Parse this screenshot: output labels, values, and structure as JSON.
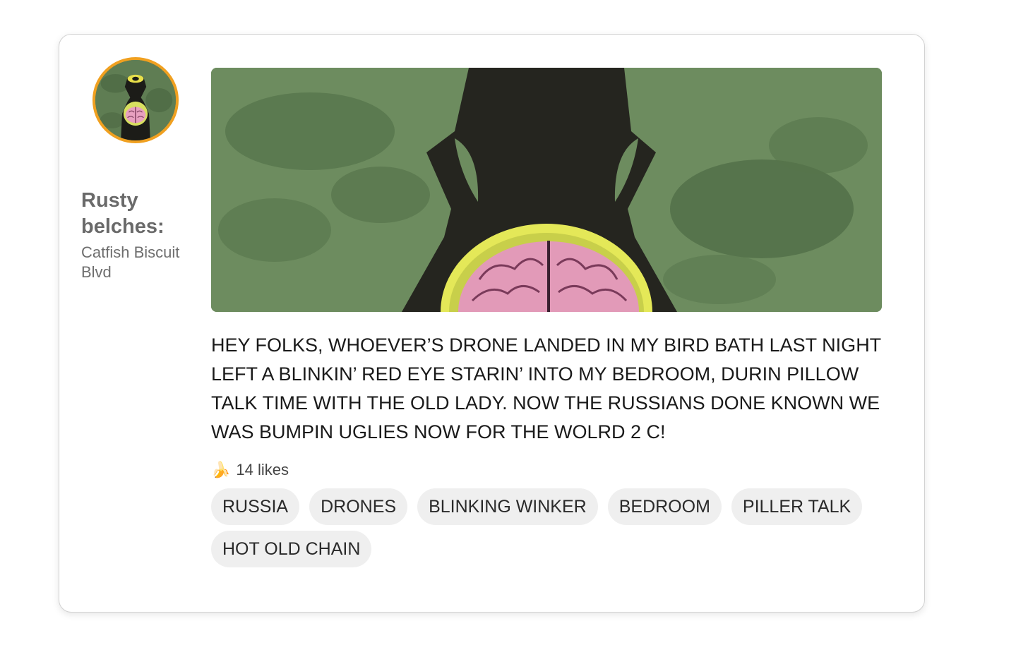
{
  "author": {
    "name": "Rusty belches:",
    "location": "Catfish Biscuit Blvd"
  },
  "post": {
    "body": "HEY FOLKS, WHOEVER’S DRONE LANDED IN MY BIRD BATH LAST NIGHT LEFT A BLINKIN’ RED EYE STARIN’ INTO MY BEDROOM, DURIN PILLOW TALK TIME WITH THE OLD LADY. NOW THE RUSSIANS DONE KNOWN WE WAS BUMPIN UGLIES NOW FOR THE WOLRD 2 C!",
    "likes_icon": "🍌",
    "likes_label": "14 likes",
    "tags": [
      "RUSSIA",
      "DRONES",
      "BLINKING WINKER",
      "BEDROOM",
      "PILLER TALK",
      "HOT OLD CHAIN"
    ]
  },
  "colors": {
    "avatar_ring": "#f0a020",
    "image_green": "#6b8a5e",
    "tag_bg": "#efefef"
  }
}
